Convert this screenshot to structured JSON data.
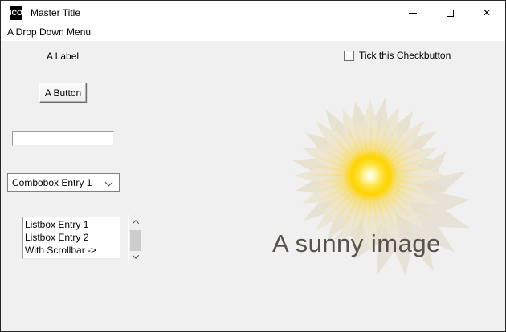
{
  "window": {
    "title": "Master Title",
    "icon_label": "ICO",
    "controls": {
      "close_glyph": "✕"
    }
  },
  "menubar": {
    "items": [
      {
        "label": "A Drop Down Menu"
      }
    ]
  },
  "content": {
    "label_text": "A Label",
    "button_label": "A Button",
    "entry": {
      "value": "",
      "placeholder": ""
    },
    "combobox": {
      "value": "Combobox Entry 1"
    },
    "listbox": {
      "items": [
        "Listbox Entry 1",
        "Listbox Entry 2",
        "With Scrollbar ->"
      ]
    },
    "checkbox": {
      "label": "Tick this Checkbutton",
      "checked": false
    },
    "image": {
      "caption": "A sunny image"
    }
  },
  "colors": {
    "titlebar_bg": "#ffffff",
    "client_bg": "#f0f0f0",
    "window_border": "#262626",
    "petal": "#ece6d5",
    "sun_core": "#ffd400",
    "caption_text": "#57524c",
    "scrollbar_thumb": "#cdcdcd"
  }
}
